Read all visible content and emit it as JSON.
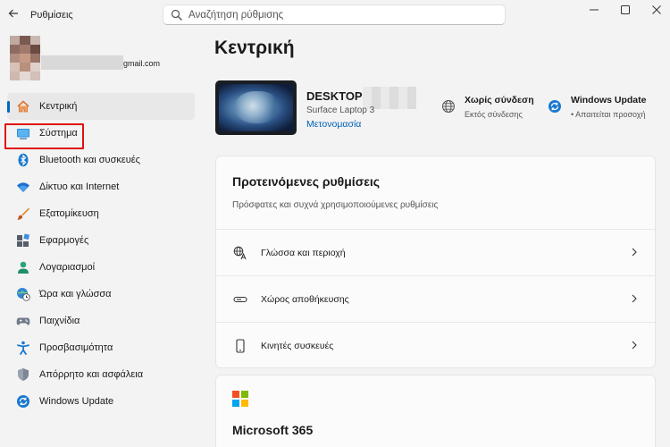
{
  "app": {
    "title": "Ρυθμίσεις"
  },
  "search": {
    "placeholder": "Αναζήτηση ρύθμισης"
  },
  "account": {
    "email": "gmail.com"
  },
  "sidebar": {
    "items": [
      {
        "label": "Κεντρική",
        "icon": "home-icon"
      },
      {
        "label": "Σύστημα",
        "icon": "system-icon"
      },
      {
        "label": "Bluetooth και συσκευές",
        "icon": "bluetooth-icon"
      },
      {
        "label": "Δίκτυο και Internet",
        "icon": "wifi-icon"
      },
      {
        "label": "Εξατομίκευση",
        "icon": "brush-icon"
      },
      {
        "label": "Εφαρμογές",
        "icon": "apps-icon"
      },
      {
        "label": "Λογαριασμοί",
        "icon": "person-icon"
      },
      {
        "label": "Ώρα και γλώσσα",
        "icon": "globe-clock-icon"
      },
      {
        "label": "Παιχνίδια",
        "icon": "gamepad-icon"
      },
      {
        "label": "Προσβασιμότητα",
        "icon": "accessibility-icon"
      },
      {
        "label": "Απόρρητο και ασφάλεια",
        "icon": "shield-icon"
      },
      {
        "label": "Windows Update",
        "icon": "update-icon"
      }
    ],
    "selected_index": 0
  },
  "main": {
    "title": "Κεντρική",
    "device": {
      "name": "DESKTOP-",
      "model": "Surface Laptop 3",
      "rename_link": "Μετονομασία"
    },
    "network_status": {
      "title": "Χωρίς σύνδεση",
      "subtitle": "Εκτός σύνδεσης"
    },
    "update_status": {
      "title": "Windows Update",
      "subtitle": "• Απαιτείται προσοχή"
    },
    "recommended": {
      "title": "Προτεινόμενες ρυθμίσεις",
      "subtitle": "Πρόσφατες και συχνά χρησιμοποιούμενες ρυθμίσεις",
      "items": [
        {
          "label": "Γλώσσα και περιοχή",
          "icon": "language-icon"
        },
        {
          "label": "Χώρος αποθήκευσης",
          "icon": "storage-icon"
        },
        {
          "label": "Κινητές συσκευές",
          "icon": "phone-icon"
        }
      ]
    },
    "microsoft365": {
      "title": "Microsoft 365"
    }
  },
  "colors": {
    "accent": "#0067c0",
    "highlight_box": "#e01010",
    "link": "#005fb8"
  }
}
